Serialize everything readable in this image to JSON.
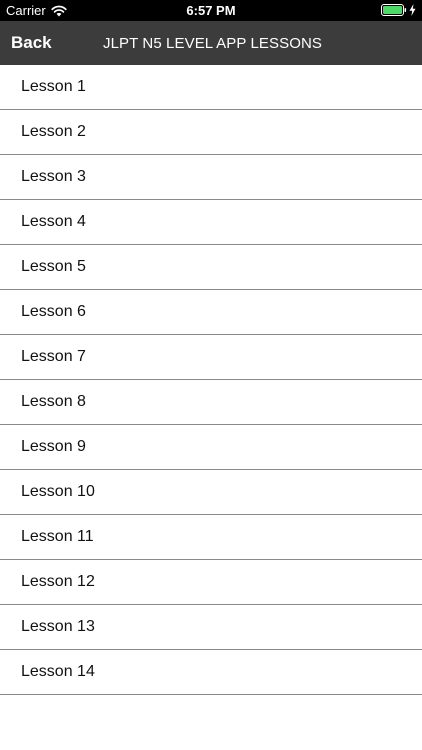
{
  "status_bar": {
    "carrier": "Carrier",
    "time": "6:57 PM",
    "icons": [
      "wifi-icon",
      "battery-icon",
      "charging-bolt-icon"
    ]
  },
  "nav": {
    "back_label": "Back",
    "title": "JLPT N5 LEVEL APP LESSONS"
  },
  "lessons": [
    "Lesson 1",
    "Lesson 2",
    "Lesson 3",
    "Lesson 4",
    "Lesson 5",
    "Lesson 6",
    "Lesson 7",
    "Lesson 8",
    "Lesson 9",
    "Lesson 10",
    "Lesson 11",
    "Lesson 12",
    "Lesson 13",
    "Lesson 14"
  ],
  "colors": {
    "status_bar_bg": "#000000",
    "nav_bar_bg": "#3c3c3c",
    "battery_fill": "#4cd964",
    "separator": "#8a8a8a"
  }
}
